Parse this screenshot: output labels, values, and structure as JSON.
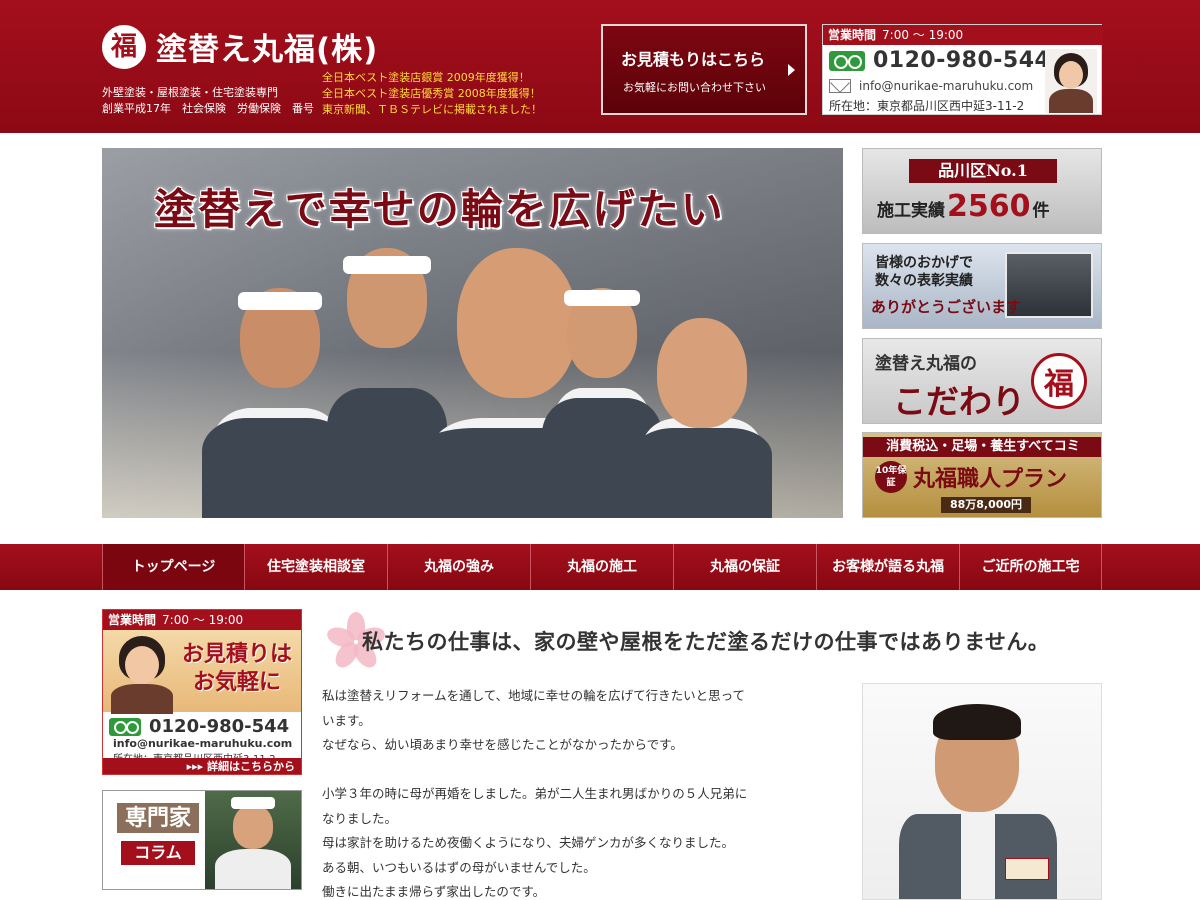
{
  "header": {
    "logo_mark": "福",
    "title": "塗替え丸福(株)",
    "tagline_1": "外壁塗装・屋根塗装・住宅塗装専門",
    "tagline_2": "創業平成17年　社会保険　労働保険　番号",
    "award_1": "全日本ベスト塗装店銀賞 2009年度獲得！",
    "award_2": "全日本ベスト塗装店優秀賞 2008年度獲得！",
    "award_3": "東京新聞、ＴＢＳテレビに掲載されました！",
    "estimate_button": {
      "title": "お見積もりはこちら",
      "subtitle": "お気軽にお問い合わせ下さい"
    },
    "contact": {
      "hours_label": "営業時間",
      "hours": "7:00 〜 19:00",
      "phone": "0120-980-544",
      "email": "info@nurikae-maruhuku.com",
      "address": "所在地：東京都品川区西中延3-11-2"
    }
  },
  "hero": {
    "banner_text": "塗替えで幸せの輪を広げたい"
  },
  "side_banners": {
    "no1": {
      "line1": "品川区No.1",
      "line2_pre": "施工実績",
      "line2_num": "2560",
      "line2_post": "件"
    },
    "awards": {
      "line1a": "皆様のおかげで",
      "line1b": "数々の表彰実績",
      "line2": "ありがとうございます"
    },
    "kodawari": {
      "line1": "塗替え丸福の",
      "line2": "こだわり",
      "seal": "福"
    },
    "plan": {
      "line1": "消費税込・足場・養生すべてコミ",
      "badge": "10年保証",
      "line2": "丸福職人プラン",
      "price": "88万8,000円"
    }
  },
  "nav": {
    "items": [
      "トップページ",
      "住宅塗装相談室",
      "丸福の強み",
      "丸福の施工",
      "丸福の保証",
      "お客様が語る丸福",
      "ご近所の施工宅"
    ]
  },
  "sidebar": {
    "hours_label": "営業時間",
    "hours": "7:00 〜 19:00",
    "promo_line1": "お見積りは",
    "promo_line2": "お気軽に",
    "phone": "0120-980-544",
    "email": "info@nurikae-maruhuku.com",
    "address": "所在地：東京都品川区西中延3-11-2",
    "more": "▸▸▸ 詳細はこちらから",
    "expert_line1": "専門家",
    "expert_line2": "コラム"
  },
  "main": {
    "headline": "私たちの仕事は、家の壁や屋根をただ塗るだけの仕事ではありません。",
    "para1": [
      "私は塗替えリフォームを通して、地域に幸せの輪を広げて行きたいと思って",
      "います。",
      "なぜなら、幼い頃あまり幸せを感じたことがなかったからです。"
    ],
    "para2": [
      "小学３年の時に母が再婚をしました。弟が二人生まれ男ばかりの５人兄弟に",
      "なりました。",
      "母は家計を助けるため夜働くようになり、夫婦ゲンカが多くなりました。",
      "ある朝、いつもいるはずの母がいませんでした。",
      "働きに出たまま帰らず家出したのです。"
    ]
  },
  "colors": {
    "brand_red": "#a40f1c",
    "dark_red": "#7a0a14",
    "award_gold": "#ffdc3a",
    "freedial_green": "#2f9a3c"
  }
}
